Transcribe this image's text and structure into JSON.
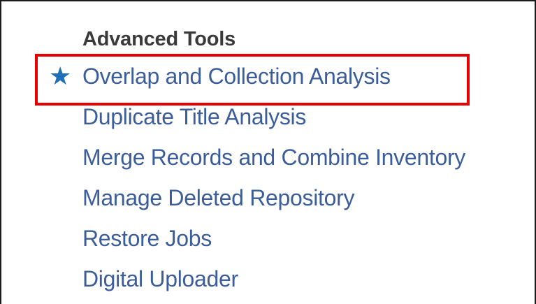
{
  "section": {
    "heading": "Advanced Tools",
    "items": [
      {
        "label": "Overlap and Collection Analysis",
        "starred": true
      },
      {
        "label": "Duplicate Title Analysis"
      },
      {
        "label": "Merge Records and Combine Inventory"
      },
      {
        "label": "Manage Deleted Repository"
      },
      {
        "label": "Restore Jobs"
      },
      {
        "label": "Digital Uploader"
      }
    ]
  },
  "icons": {
    "favorite": "star-icon"
  },
  "colors": {
    "link": "#3b5d9a",
    "star": "#1e6fb8",
    "heading": "#3a3a3a",
    "highlight": "#e60000"
  }
}
